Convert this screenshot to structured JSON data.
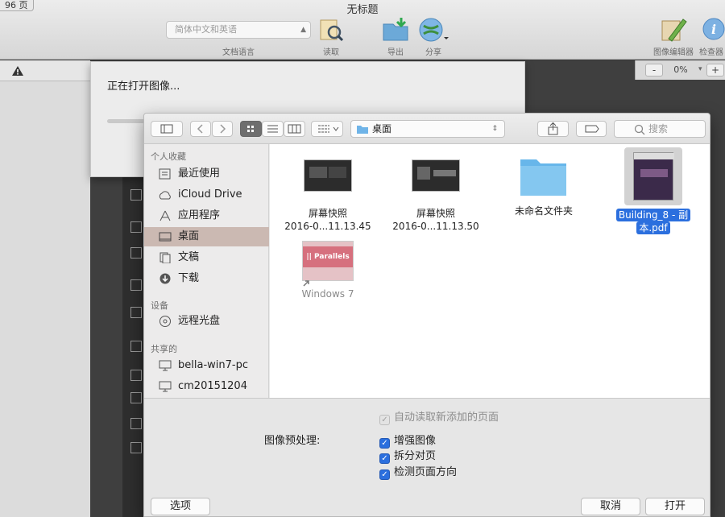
{
  "page_count": "96 页",
  "window": {
    "title": "无标题"
  },
  "toolbar": {
    "language_select": "简体中文和英语",
    "language_caption": "文档语言",
    "read_label": "读取",
    "export_label": "导出",
    "share_label": "分享",
    "image_editor_label": "图像编辑器",
    "inspector_label": "检查器"
  },
  "zoom": {
    "value": "0%",
    "minus": "-",
    "plus": "+"
  },
  "progress": {
    "text": "正在打开图像..."
  },
  "dialog": {
    "location": "桌面",
    "search_placeholder": "搜索",
    "sidebar": {
      "favorites_header": "个人收藏",
      "favorites": [
        {
          "label": "最近使用",
          "icon": "recents-icon"
        },
        {
          "label": "iCloud Drive",
          "icon": "cloud-icon"
        },
        {
          "label": "应用程序",
          "icon": "applications-icon"
        },
        {
          "label": "桌面",
          "icon": "desktop-icon",
          "selected": true
        },
        {
          "label": "文稿",
          "icon": "documents-icon"
        },
        {
          "label": "下载",
          "icon": "downloads-icon"
        }
      ],
      "devices_header": "设备",
      "devices": [
        {
          "label": "远程光盘",
          "icon": "disc-icon"
        }
      ],
      "shared_header": "共享的",
      "shared": [
        {
          "label": "bella-win7-pc",
          "icon": "computer-icon"
        },
        {
          "label": "cm20151204",
          "icon": "computer-icon"
        }
      ]
    },
    "files": [
      {
        "line1": "屏幕快照",
        "line2": "2016-0...11.13.45"
      },
      {
        "line1": "屏幕快照",
        "line2": "2016-0...11.13.50"
      },
      {
        "line1": "未命名文件夹",
        "line2": ""
      },
      {
        "line1": "Building_8 - 副",
        "line2": "本.pdf",
        "selected": true
      },
      {
        "line1": "Windows 7",
        "line2": "",
        "dimmed": true,
        "thumb_text": "|| Parallels"
      }
    ],
    "options": {
      "auto_read": "自动读取新添加的页面",
      "preprocess_label": "图像预处理:",
      "enhance": "增强图像",
      "split": "拆分对页",
      "detect_orientation": "检测页面方向"
    },
    "buttons": {
      "options": "选项",
      "cancel": "取消",
      "open": "打开"
    }
  },
  "colors": {
    "accent": "#2b6fde",
    "selection_sidebar": "#cbb9b2"
  }
}
